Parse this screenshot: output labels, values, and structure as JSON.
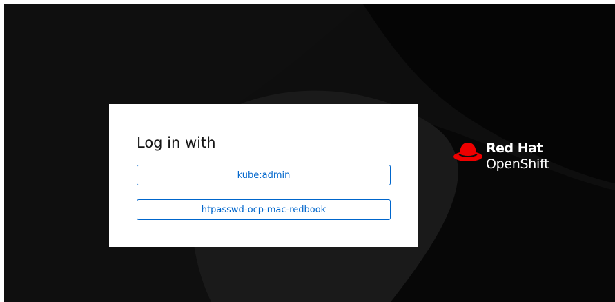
{
  "login": {
    "title": "Log in with",
    "providers": [
      {
        "label": "kube:admin"
      },
      {
        "label": "htpasswd-ocp-mac-redbook"
      }
    ]
  },
  "brand": {
    "line1": "Red Hat",
    "line2": "OpenShift",
    "logo_icon": "red-hat-fedora-icon"
  },
  "colors": {
    "background": "#0e0e0e",
    "card": "#ffffff",
    "link": "#0066cc",
    "brand_red": "#ee0000"
  }
}
